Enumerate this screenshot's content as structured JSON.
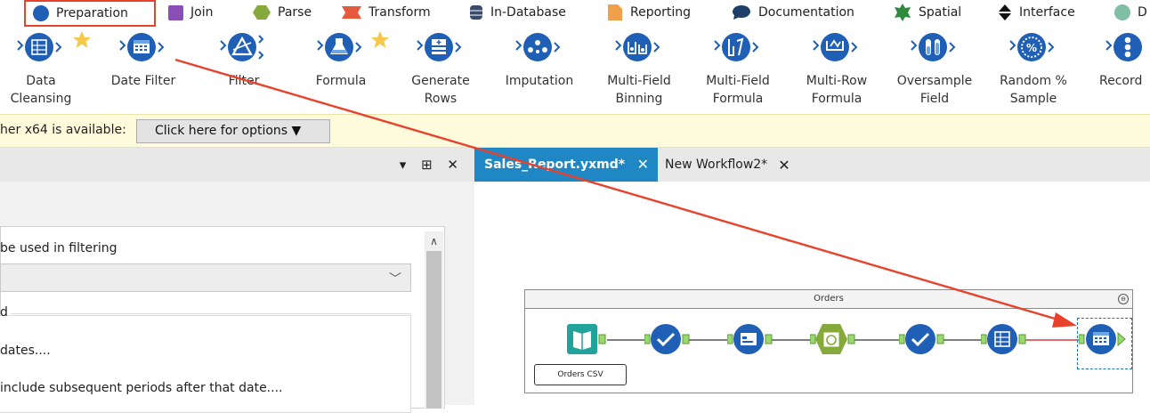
{
  "category_tabs": [
    {
      "label": "Preparation",
      "color": "#1f5fb5",
      "shape": "circle",
      "icon": "preparation-icon",
      "selected": true
    },
    {
      "label": "Join",
      "color": "#8a4fb5",
      "shape": "square",
      "icon": "join-icon"
    },
    {
      "label": "Parse",
      "color": "#86a93c",
      "shape": "hexagon",
      "icon": "parse-icon"
    },
    {
      "label": "Transform",
      "color": "#e55a3c",
      "shape": "ribbon",
      "icon": "transform-icon"
    },
    {
      "label": "In-Database",
      "color": "#3a4a6b",
      "shape": "cylinder",
      "icon": "in-database-icon"
    },
    {
      "label": "Reporting",
      "color": "#f0a04b",
      "shape": "document",
      "icon": "reporting-icon"
    },
    {
      "label": "Documentation",
      "color": "#1f3f6b",
      "shape": "bubble",
      "icon": "documentation-icon"
    },
    {
      "label": "Spatial",
      "color": "#2e8b3e",
      "shape": "star",
      "icon": "spatial-icon"
    },
    {
      "label": "Interface",
      "color": "#111111",
      "shape": "diamond",
      "icon": "interface-icon"
    },
    {
      "label": "D",
      "color": "#7fbfa6",
      "shape": "circle",
      "icon": "data-investigation-icon"
    }
  ],
  "tools": [
    {
      "label": "Data\nCleansing",
      "icon": "data-cleansing-icon",
      "favorite": true
    },
    {
      "label": "Date Filter",
      "icon": "date-filter-icon",
      "favorite": false
    },
    {
      "label": "Filter",
      "icon": "filter-icon",
      "favorite": false
    },
    {
      "label": "Formula",
      "icon": "formula-icon",
      "favorite": true
    },
    {
      "label": "Generate\nRows",
      "icon": "generate-rows-icon",
      "favorite": false
    },
    {
      "label": "Imputation",
      "icon": "imputation-icon",
      "favorite": false
    },
    {
      "label": "Multi-Field\nBinning",
      "icon": "multi-field-binning-icon",
      "favorite": false
    },
    {
      "label": "Multi-Field\nFormula",
      "icon": "multi-field-formula-icon",
      "favorite": false
    },
    {
      "label": "Multi-Row\nFormula",
      "icon": "multi-row-formula-icon",
      "favorite": false
    },
    {
      "label": "Oversample\nField",
      "icon": "oversample-field-icon",
      "favorite": false
    },
    {
      "label": "Random %\nSample",
      "icon": "random-sample-icon",
      "favorite": false
    },
    {
      "label": "Record",
      "icon": "record-id-icon",
      "favorite": false
    }
  ],
  "info_bar": {
    "text": "her x64 is available:",
    "button_label": "Click here for options ▼"
  },
  "config_panel": {
    "header_controls": "▾ ⊞ ✕",
    "field_prompt": "be used in filtering",
    "group_caption": "d",
    "options": [
      "dates....",
      "include subsequent periods after that date...."
    ]
  },
  "doc_tabs": [
    {
      "label": "Sales_Report.yxmd*",
      "active": true
    },
    {
      "label": "New Workflow2*",
      "active": false
    }
  ],
  "canvas": {
    "container_title": "Orders",
    "input_label": "Orders CSV",
    "nodes": [
      {
        "icon": "input-data-icon",
        "color": "#1fa39a"
      },
      {
        "icon": "select-icon",
        "color": "#1f5fb5"
      },
      {
        "icon": "browse-icon",
        "color": "#1f5fb5"
      },
      {
        "icon": "datetime-icon",
        "color": "#86a93c"
      },
      {
        "icon": "select-icon",
        "color": "#1f5fb5"
      },
      {
        "icon": "data-cleansing-icon",
        "color": "#1f5fb5"
      },
      {
        "icon": "date-filter-icon",
        "color": "#1f5fb5"
      }
    ]
  },
  "annotation": {
    "arrow_color": "#e8422c"
  }
}
